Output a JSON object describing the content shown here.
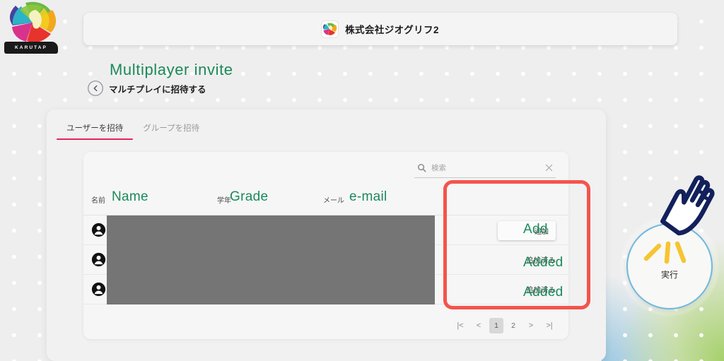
{
  "brand": {
    "logo_name": "KARUTAP",
    "logo_icon": "karutap-pinwheel-icon"
  },
  "appbar": {
    "title": "株式会社ジオグリフ2",
    "icon": "app-tile-icon"
  },
  "page": {
    "annotation_title": "Multiplayer  invite",
    "breadcrumb_label": "マルチプレイに招待する",
    "back_icon": "back-arrow-icon"
  },
  "tabs": [
    {
      "label": "ユーザーを招待",
      "active": true
    },
    {
      "label": "グループを招待",
      "active": false
    }
  ],
  "search": {
    "placeholder": "検索",
    "value": "",
    "search_icon": "search-icon",
    "clear_icon": "close-icon"
  },
  "table": {
    "columns": [
      {
        "jp": "名前",
        "en": "Name"
      },
      {
        "jp": "学年",
        "en": "Grade"
      },
      {
        "jp": "メール",
        "en": "e-mail"
      }
    ],
    "rows": [
      {
        "avatar_icon": "account-circle-icon",
        "action_jp": "追加",
        "action_en": "Add",
        "action_type": "button"
      },
      {
        "avatar_icon": "account-circle-icon",
        "action_jp": "追加済み",
        "action_en": "Added",
        "action_type": "text"
      },
      {
        "avatar_icon": "account-circle-icon",
        "action_jp": "追加済み",
        "action_en": "Added",
        "action_type": "text"
      }
    ]
  },
  "pagination": {
    "first": "|<",
    "prev": "<",
    "pages": [
      "1",
      "2"
    ],
    "current": "1",
    "next": ">",
    "last": ">|"
  },
  "execute": {
    "label": "実行",
    "ring_color": "#6fb9dd",
    "ray_color": "#f5c531"
  },
  "annotation": {
    "box_color": "#f4544c",
    "text_color": "#1a8a5a",
    "cursor_icon": "hand-pointer-icon",
    "cursor_color": "#12205c"
  }
}
